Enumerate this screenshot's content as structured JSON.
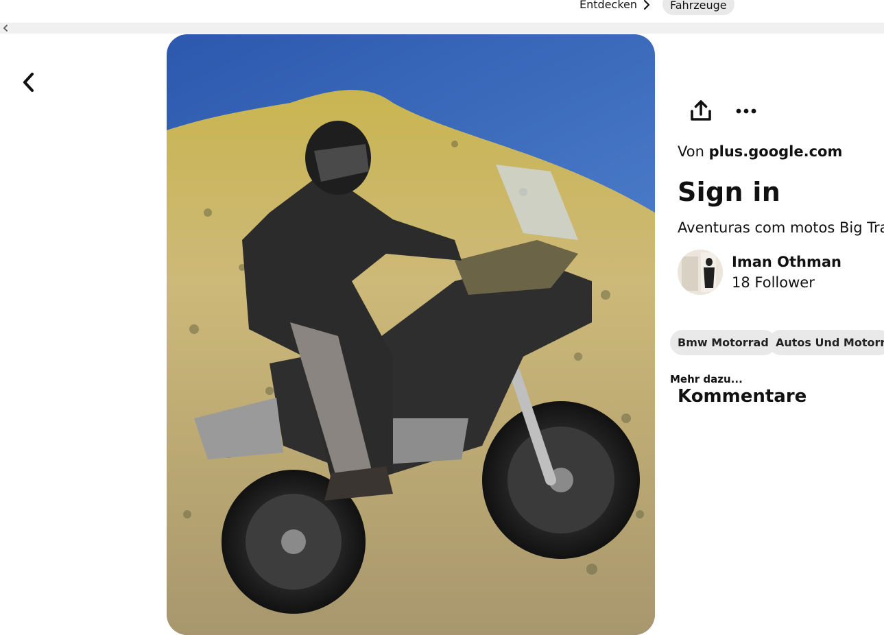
{
  "breadcrumb": {
    "items": [
      {
        "label": "Entdecken"
      },
      {
        "label": "Fahrzeuge"
      }
    ]
  },
  "nav": {
    "back_icon": "chevron-left-icon",
    "scroll_left_icon": "chevron-left-icon"
  },
  "pin": {
    "image_subject": "motorcycle",
    "actions": {
      "share_icon": "share-icon",
      "more_icon": "more-options-icon"
    },
    "source_prefix": "Von",
    "source_domain": "plus.google.com",
    "title": "Sign in",
    "description": "Aventuras com motos Big Trail",
    "author": {
      "name": "Iman Othman",
      "followers": "18 Follower"
    },
    "tags": [
      "Bmw Motorrad",
      "Autos Und Motorräd"
    ],
    "more_label": "Mehr dazu...",
    "comments_heading": "Kommentare"
  },
  "colors": {
    "chip_background": "#e9e9e9",
    "text": "#111111",
    "sky": "#2f63b8",
    "hillside": "#c9b467"
  }
}
